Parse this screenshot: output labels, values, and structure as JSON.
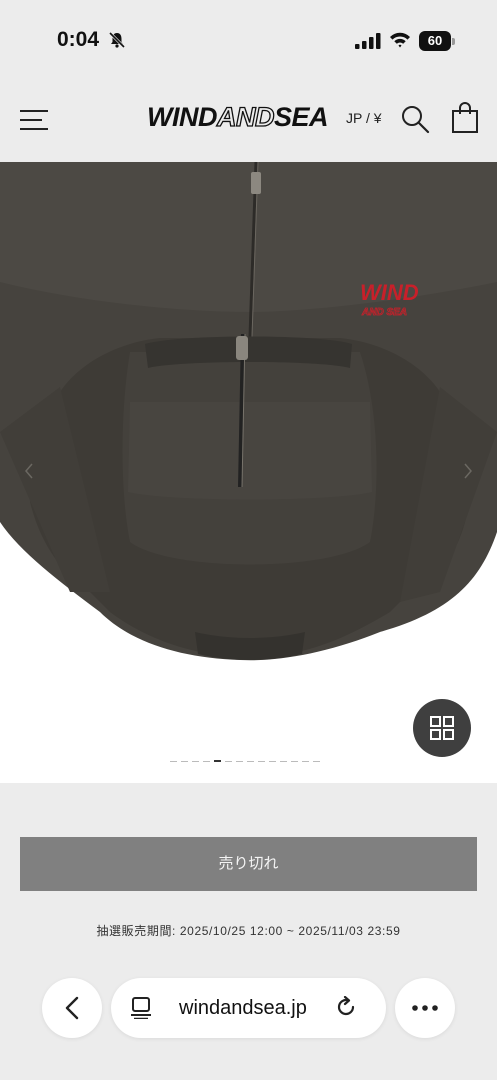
{
  "status_bar": {
    "time": "0:04",
    "battery": "60"
  },
  "header": {
    "logo_part1": "WIND",
    "logo_part2": "AND",
    "logo_part3": "SEA",
    "locale": "JP / ¥"
  },
  "product": {
    "image_description_icon": "zip-hoodie-photo",
    "embroidery_top": "WIND",
    "embroidery_bottom": "AND SEA",
    "gallery_total_images": 14,
    "gallery_active_index": 4,
    "sold_out_label": "売り切れ",
    "lottery_period": "抽選販売期間: 2025/10/25 12:00 ~ 2025/11/03 23:59"
  },
  "browser": {
    "url": "windandsea.jp"
  },
  "colors": {
    "garment": "#45423d",
    "embroidery": "#c8202a",
    "sold_out_bg": "#808080",
    "background": "#ececec"
  }
}
